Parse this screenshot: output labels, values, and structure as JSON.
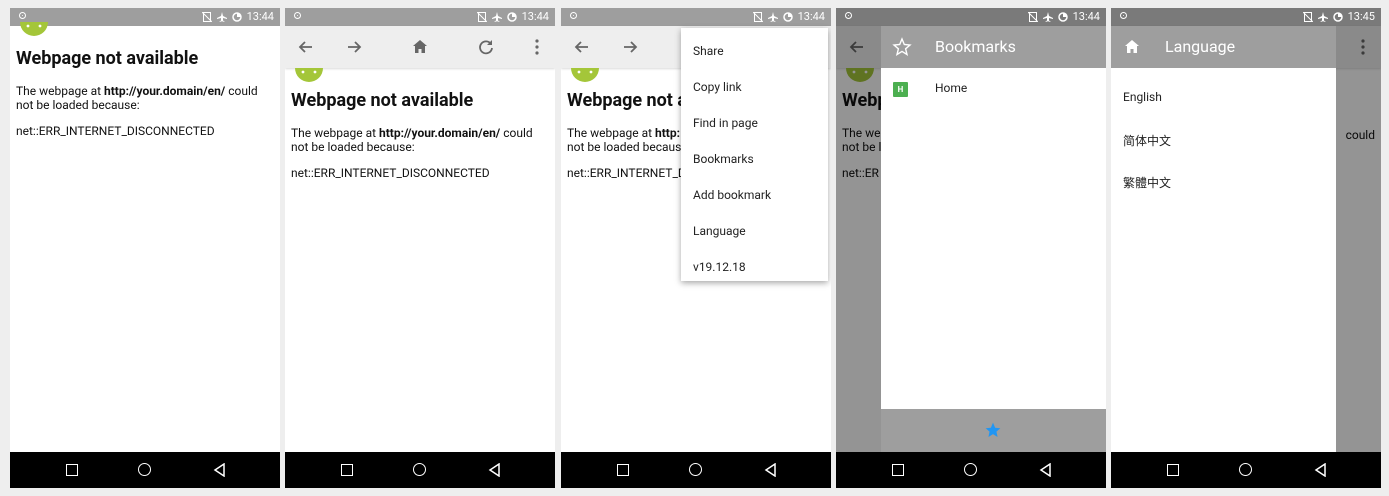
{
  "status": {
    "time_1": "13:44",
    "time_2": "13:44",
    "time_3": "13:44",
    "time_4": "13:44",
    "time_5": "13:45"
  },
  "error_page": {
    "title": "Webpage not available",
    "body_prefix": "The webpage at ",
    "url": "http://your.domain/en/",
    "body_suffix": " could not be loaded because:",
    "code": "net::ERR_INTERNET_DISCONNECTED",
    "title_truncated": "Webpage not a",
    "body_truncated_prefix": "The webpage at ",
    "url_truncated": "http:",
    "body_line2_truncated": "not be loaded becaus",
    "code_truncated": "net::ERR_INTERNET_D",
    "title_partial": "Webp",
    "body_partial_1": "The we",
    "body_partial_2": "not be l",
    "code_partial": "net::ER",
    "right_partial": "could"
  },
  "menu": {
    "items": [
      "Share",
      "Copy link",
      "Find in page",
      "Bookmarks",
      "Add bookmark",
      "Language",
      "v19.12.18"
    ]
  },
  "bookmarks": {
    "title": "Bookmarks",
    "items": [
      {
        "badge": "H",
        "label": "Home"
      }
    ]
  },
  "language": {
    "title": "Language",
    "items": [
      "English",
      "简体中文",
      "繁體中文"
    ]
  },
  "icons": {
    "back": "back-arrow-icon",
    "forward": "forward-arrow-icon",
    "home": "home-icon",
    "reload": "reload-icon",
    "more": "more-vert-icon",
    "star": "star-icon"
  },
  "colors": {
    "accent": "#2196f3",
    "badge": "#4caf50",
    "android": "#a4c639",
    "statusbar": "#9e9e9e"
  }
}
